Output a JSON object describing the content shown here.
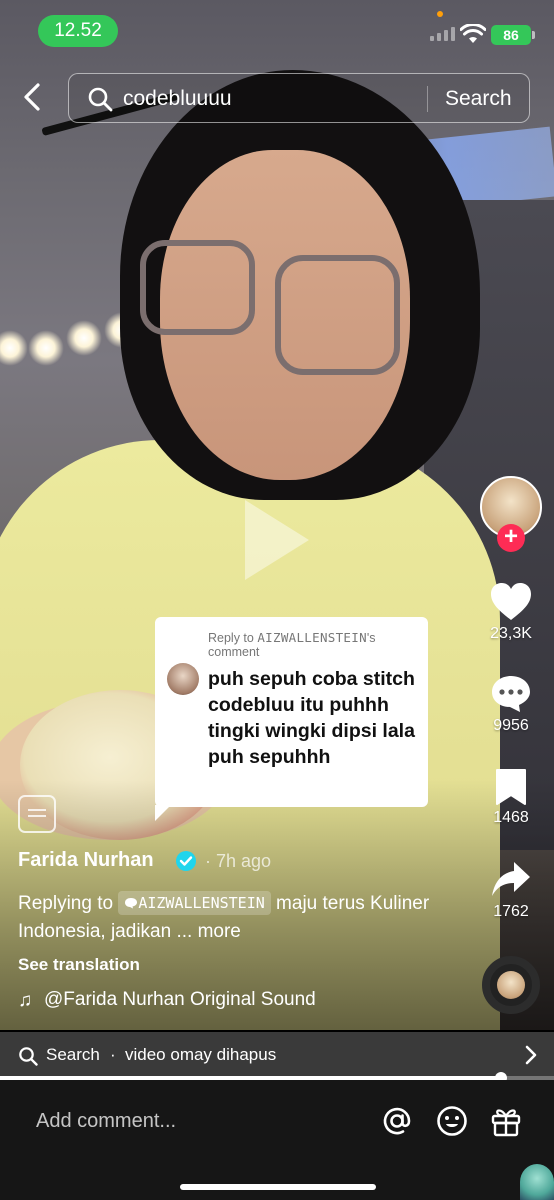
{
  "status_bar": {
    "time": "12.52",
    "battery": "86"
  },
  "search": {
    "query": "codebluuuu",
    "button": "Search"
  },
  "actions": {
    "likes": "23,3K",
    "comments": "9956",
    "saves": "1468",
    "shares": "1762"
  },
  "reply_sticker": {
    "label_prefix": "Reply to ",
    "username": "AIZWALLENSTEIN",
    "label_suffix": "'s comment",
    "text": "puh sepuh coba stitch codebluu itu puhhh tingki wingki dipsi lala puh sepuhhh"
  },
  "post": {
    "author": "Farida Nurhan",
    "time_ago": "· 7h ago",
    "caption_prefix": "Replying to",
    "caption_mention": "AIZWALLENSTEIN",
    "caption_text": " maju terus  Kuliner Indonesia, jadikan ... ",
    "more": "more",
    "see_translation": "See translation",
    "sound": "@Farida Nurhan Original Sound"
  },
  "search_suggestion": {
    "label": "Search",
    "separator": "·",
    "query": "video omay dihapus"
  },
  "progress": {
    "fraction": 0.905
  },
  "comment_bar": {
    "placeholder": "Add comment..."
  },
  "colors": {
    "like_accent": "#fe2c55",
    "status_green": "#34c759",
    "verified": "#20d5ec"
  }
}
